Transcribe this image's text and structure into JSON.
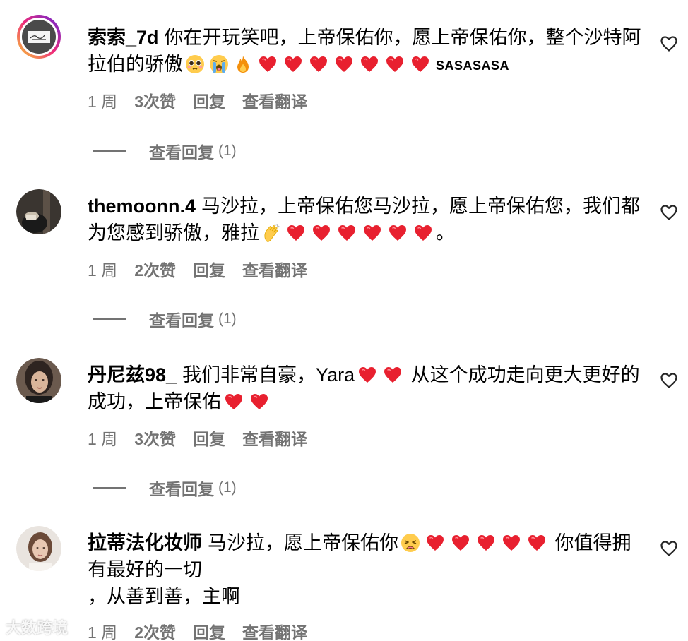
{
  "comments": [
    {
      "username": "索索_7d",
      "text_before": "你在开玩笑吧，上帝保佑你，愿上帝保佑你，整个沙特阿拉伯的骄傲",
      "tail": "SASASASA",
      "time": "1 周",
      "likes": "3次赞",
      "reply": "回复",
      "translate": "查看翻译",
      "view_replies": "查看回复",
      "reply_count": "(1)"
    },
    {
      "username": "themoonn.4",
      "text_before": "马沙拉，上帝保佑您马沙拉，愿上帝保佑您，我们都为您感到骄傲，雅拉",
      "tail": "。",
      "time": "1 周",
      "likes": "2次赞",
      "reply": "回复",
      "translate": "查看翻译",
      "view_replies": "查看回复",
      "reply_count": "(1)"
    },
    {
      "username": "丹尼兹98_",
      "text_before": "我们非常自豪，Yara",
      "text_middle": "从这个成功走向更大更好的成功，上帝保佑",
      "time": "1 周",
      "likes": "3次赞",
      "reply": "回复",
      "translate": "查看翻译",
      "view_replies": "查看回复",
      "reply_count": "(1)"
    },
    {
      "username": "拉蒂法化妆师",
      "text_before": "马沙拉，愿上帝保佑你",
      "text_middle": "你值得拥有最好的一切",
      "text_after": "，从善到善，主啊",
      "time": "1 周",
      "likes": "2次赞",
      "reply": "回复",
      "translate": "查看翻译"
    }
  ],
  "icons": {
    "like": "heart-outline-icon",
    "heart": "red-heart-emoji",
    "pleading": "pleading-face-emoji",
    "crying": "loudly-crying-face-emoji",
    "fire": "fire-emoji",
    "clap": "clapping-hands-emoji",
    "weary": "weary-face-emoji"
  },
  "colors": {
    "heart": "#e8202f",
    "meta": "#737373",
    "ring_start": "#f9ce34",
    "ring_mid": "#ee2a7b",
    "ring_end": "#6228d7"
  },
  "watermark": "大数跨境"
}
